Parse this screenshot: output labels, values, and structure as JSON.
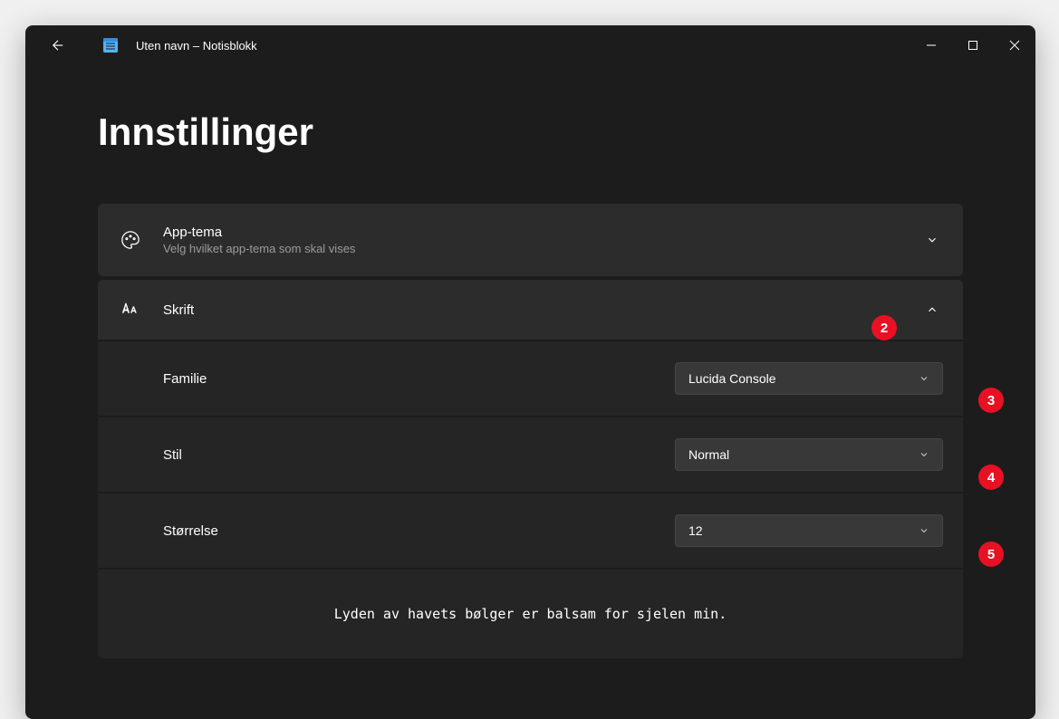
{
  "window": {
    "title": "Uten navn – Notisblokk"
  },
  "page": {
    "heading": "Innstillinger"
  },
  "appTheme": {
    "title": "App-tema",
    "subtitle": "Velg hvilket app-tema som skal vises"
  },
  "font": {
    "title": "Skrift",
    "family": {
      "label": "Familie",
      "value": "Lucida Console"
    },
    "style": {
      "label": "Stil",
      "value": "Normal"
    },
    "size": {
      "label": "Størrelse",
      "value": "12"
    },
    "preview": "Lyden av havets bølger er balsam for sjelen min."
  },
  "annotations": {
    "a2": "2",
    "a3": "3",
    "a4": "4",
    "a5": "5"
  }
}
